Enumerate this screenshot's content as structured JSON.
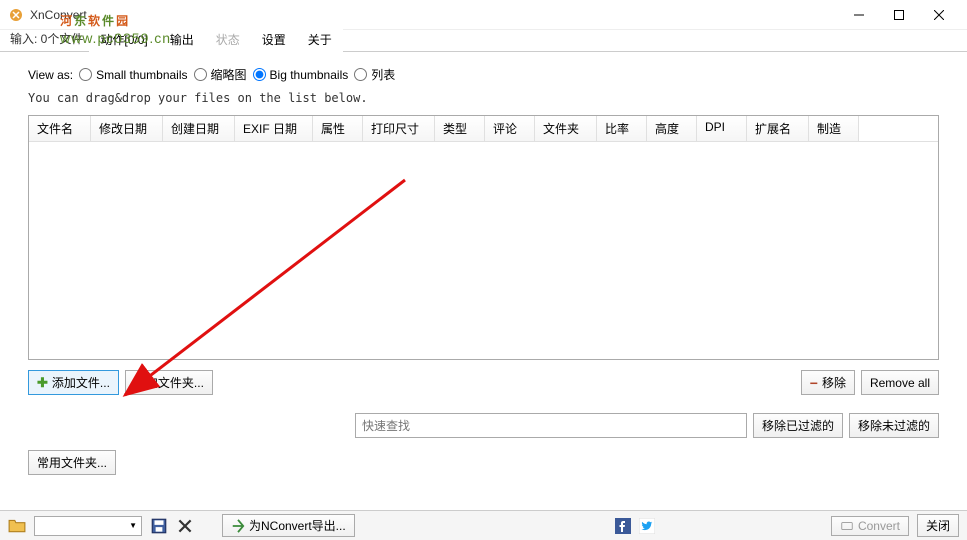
{
  "titlebar": {
    "title": "XnConvert"
  },
  "watermark": {
    "title_chars": [
      "河",
      "东",
      "软",
      "件",
      "园"
    ],
    "url": "www.pc0359.cn"
  },
  "tabs": {
    "input_label": "输入: ",
    "input_count": "0个文件",
    "actions": "动作[0/0]",
    "output": "输出",
    "status": "状态",
    "settings": "设置",
    "about": "关于"
  },
  "view_as": {
    "label": "View as:",
    "small": "Small thumbnails",
    "medium": "缩略图",
    "big": "Big thumbnails",
    "list": "列表"
  },
  "hint": "You can drag&drop your files on the list below.",
  "columns": [
    "文件名",
    "修改日期",
    "创建日期",
    "EXIF 日期",
    "属性",
    "打印尺寸",
    "类型",
    "评论",
    "文件夹",
    "比率",
    "高度",
    "DPI",
    "扩展名",
    "制造"
  ],
  "buttons": {
    "add_file": "添加文件...",
    "add_folder": "添加文件夹...",
    "remove": "移除",
    "remove_all": "Remove all",
    "remove_filtered": "移除已过滤的",
    "remove_unfiltered": "移除未过滤的",
    "common_folder": "常用文件夹...",
    "nconvert_export": "为NConvert导出...",
    "convert": "Convert",
    "close": "关闭"
  },
  "search": {
    "placeholder": "快速查找"
  }
}
